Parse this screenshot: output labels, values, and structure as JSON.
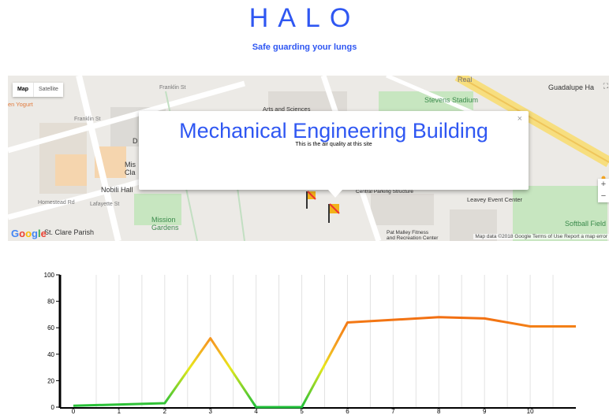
{
  "header": {
    "title": "HALO",
    "tagline": "Safe guarding your lungs"
  },
  "map": {
    "map_type_map": "Map",
    "map_type_satellite": "Satellite",
    "labels": {
      "franklin_st_1": "Franklin St",
      "franklin_st_2": "Franklin St",
      "yogurt": "en Yogurt",
      "arts_sciences": "Arts and Sciences",
      "stevens_stadium": "Stevens Stadium",
      "guadalupe": "Guadalupe Ha",
      "real": "Real",
      "homestead": "Homestead Rd",
      "nobili": "Nobili Hall",
      "lafayette": "Lafayette St",
      "mission_gardens": "Mission\nGardens",
      "central_parking": "Central Parking Structure",
      "leavey": "Leavey Event Center",
      "softball": "Softball Field",
      "malley": "Pat Malley Fitness\nand Recreation Center",
      "st_clare": "St. Clare Parish",
      "mis_cla": "Mis\nCla",
      "d_label": "D"
    },
    "popup": {
      "title": "Mechanical Engineering Building",
      "subtitle": "This is the air quality at this site",
      "close": "×"
    },
    "zoom_in": "+",
    "zoom_out": "−",
    "google_logo": "Google",
    "attribution": "Map data ©2018 Google  Terms of Use  Report a map error",
    "colors": {
      "accent": "#2f57f2",
      "park": "#c7e6c0",
      "road": "#ffffff",
      "highway": "#f7de7f"
    }
  },
  "chart_data": {
    "type": "line",
    "x": [
      0,
      2,
      3,
      4,
      5,
      6,
      8,
      9,
      10,
      11
    ],
    "y": [
      1,
      3,
      52,
      0,
      0,
      64,
      68,
      67,
      61,
      61
    ],
    "xticks": [
      0,
      1,
      2,
      3,
      4,
      5,
      6,
      7,
      8,
      9,
      10
    ],
    "yticks": [
      0,
      20,
      40,
      60,
      80,
      100
    ],
    "xlim": [
      0,
      11
    ],
    "ylim": [
      0,
      100
    ],
    "grid": "vertical",
    "colors": {
      "low": "#1fbf3a",
      "mid": "#e8e81a",
      "high": "#f26a10"
    }
  }
}
